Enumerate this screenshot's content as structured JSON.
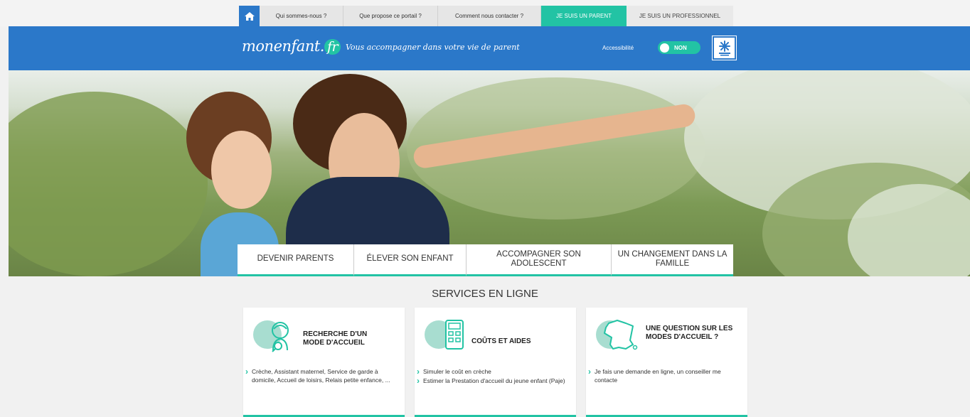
{
  "topnav": {
    "links": [
      "Qui sommes-nous ?",
      "Que propose ce portail ?",
      "Comment nous contacter ?"
    ],
    "parent_tab": "JE SUIS UN PARENT",
    "pro_tab": "JE SUIS UN PROFESSIONNEL"
  },
  "header": {
    "logo_main": "monenfant.",
    "logo_fr": "fr",
    "tagline": "Vous accompagner dans votre vie de parent",
    "accessibility_label": "Accessibilité",
    "accessibility_toggle": "NON"
  },
  "hero_nav": [
    "DEVENIR PARENTS",
    "ÉLEVER SON ENFANT",
    "ACCOMPAGNER SON ADOLESCENT",
    "UN CHANGEMENT DANS LA FAMILLE"
  ],
  "services": {
    "title": "SERVICES EN LIGNE",
    "cards": [
      {
        "title": "RECHERCHE D'UN MODE D'ACCUEIL",
        "items": [
          "Crèche, Assistant maternel, Service de garde à domicile, Accueil de loisirs, Relais petite enfance, ..."
        ]
      },
      {
        "title": "COÛTS ET AIDES",
        "items": [
          "Simuler le coût en crèche",
          "Estimer la Prestation d'accueil du jeune enfant (Paje)"
        ]
      },
      {
        "title": "UNE QUESTION SUR LES MODES D'ACCUEIL ?",
        "items": [
          "Je fais une demande en ligne, un conseiller me contacte"
        ]
      }
    ]
  },
  "colors": {
    "blue": "#2b78c9",
    "teal": "#22c3a4",
    "page_bg": "#f1f1f1"
  },
  "icons": [
    "home-icon",
    "caf-logo-icon",
    "child-search-icon",
    "calculator-icon",
    "france-map-icon"
  ]
}
